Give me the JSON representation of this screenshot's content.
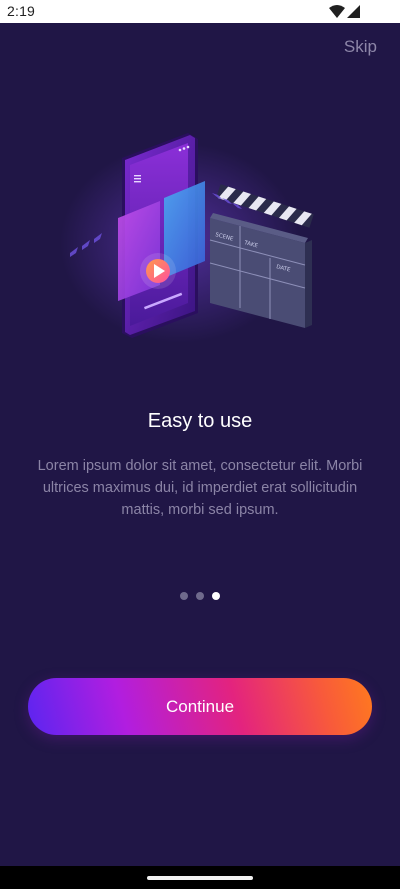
{
  "status_bar": {
    "time": "2:19",
    "icons": [
      "wifi-icon",
      "signal-icon"
    ]
  },
  "onboarding": {
    "skip_label": "Skip",
    "title": "Easy to use",
    "description": "Lorem ipsum dolor sit amet, consectetur elit. Morbi ultrices maximus dui, id imperdiet erat sollicitudin mattis, morbi sed ipsum.",
    "pagination": {
      "total": 3,
      "current": 3
    },
    "continue_label": "Continue",
    "illustration": {
      "icon": "video-player-clapperboard-illustration",
      "clapperboard_labels": [
        "SCENE",
        "TAKE",
        "DATE"
      ]
    }
  },
  "colors": {
    "background": "#201646",
    "button_gradient_start": "#5b25f0",
    "button_gradient_end": "#ff7a1e",
    "text_muted": "#8b84a6"
  }
}
